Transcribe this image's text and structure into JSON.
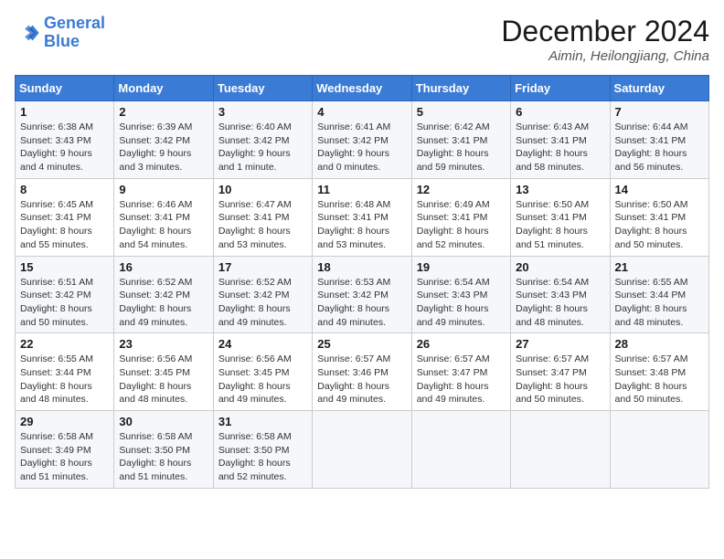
{
  "header": {
    "logo_line1": "General",
    "logo_line2": "Blue",
    "month_title": "December 2024",
    "location": "Aimin, Heilongjiang, China"
  },
  "days_of_week": [
    "Sunday",
    "Monday",
    "Tuesday",
    "Wednesday",
    "Thursday",
    "Friday",
    "Saturday"
  ],
  "weeks": [
    [
      {
        "day": "1",
        "sunrise": "6:38 AM",
        "sunset": "3:43 PM",
        "daylight": "9 hours and 4 minutes."
      },
      {
        "day": "2",
        "sunrise": "6:39 AM",
        "sunset": "3:42 PM",
        "daylight": "9 hours and 3 minutes."
      },
      {
        "day": "3",
        "sunrise": "6:40 AM",
        "sunset": "3:42 PM",
        "daylight": "9 hours and 1 minute."
      },
      {
        "day": "4",
        "sunrise": "6:41 AM",
        "sunset": "3:42 PM",
        "daylight": "9 hours and 0 minutes."
      },
      {
        "day": "5",
        "sunrise": "6:42 AM",
        "sunset": "3:41 PM",
        "daylight": "8 hours and 59 minutes."
      },
      {
        "day": "6",
        "sunrise": "6:43 AM",
        "sunset": "3:41 PM",
        "daylight": "8 hours and 58 minutes."
      },
      {
        "day": "7",
        "sunrise": "6:44 AM",
        "sunset": "3:41 PM",
        "daylight": "8 hours and 56 minutes."
      }
    ],
    [
      {
        "day": "8",
        "sunrise": "6:45 AM",
        "sunset": "3:41 PM",
        "daylight": "8 hours and 55 minutes."
      },
      {
        "day": "9",
        "sunrise": "6:46 AM",
        "sunset": "3:41 PM",
        "daylight": "8 hours and 54 minutes."
      },
      {
        "day": "10",
        "sunrise": "6:47 AM",
        "sunset": "3:41 PM",
        "daylight": "8 hours and 53 minutes."
      },
      {
        "day": "11",
        "sunrise": "6:48 AM",
        "sunset": "3:41 PM",
        "daylight": "8 hours and 53 minutes."
      },
      {
        "day": "12",
        "sunrise": "6:49 AM",
        "sunset": "3:41 PM",
        "daylight": "8 hours and 52 minutes."
      },
      {
        "day": "13",
        "sunrise": "6:50 AM",
        "sunset": "3:41 PM",
        "daylight": "8 hours and 51 minutes."
      },
      {
        "day": "14",
        "sunrise": "6:50 AM",
        "sunset": "3:41 PM",
        "daylight": "8 hours and 50 minutes."
      }
    ],
    [
      {
        "day": "15",
        "sunrise": "6:51 AM",
        "sunset": "3:42 PM",
        "daylight": "8 hours and 50 minutes."
      },
      {
        "day": "16",
        "sunrise": "6:52 AM",
        "sunset": "3:42 PM",
        "daylight": "8 hours and 49 minutes."
      },
      {
        "day": "17",
        "sunrise": "6:52 AM",
        "sunset": "3:42 PM",
        "daylight": "8 hours and 49 minutes."
      },
      {
        "day": "18",
        "sunrise": "6:53 AM",
        "sunset": "3:42 PM",
        "daylight": "8 hours and 49 minutes."
      },
      {
        "day": "19",
        "sunrise": "6:54 AM",
        "sunset": "3:43 PM",
        "daylight": "8 hours and 49 minutes."
      },
      {
        "day": "20",
        "sunrise": "6:54 AM",
        "sunset": "3:43 PM",
        "daylight": "8 hours and 48 minutes."
      },
      {
        "day": "21",
        "sunrise": "6:55 AM",
        "sunset": "3:44 PM",
        "daylight": "8 hours and 48 minutes."
      }
    ],
    [
      {
        "day": "22",
        "sunrise": "6:55 AM",
        "sunset": "3:44 PM",
        "daylight": "8 hours and 48 minutes."
      },
      {
        "day": "23",
        "sunrise": "6:56 AM",
        "sunset": "3:45 PM",
        "daylight": "8 hours and 48 minutes."
      },
      {
        "day": "24",
        "sunrise": "6:56 AM",
        "sunset": "3:45 PM",
        "daylight": "8 hours and 49 minutes."
      },
      {
        "day": "25",
        "sunrise": "6:57 AM",
        "sunset": "3:46 PM",
        "daylight": "8 hours and 49 minutes."
      },
      {
        "day": "26",
        "sunrise": "6:57 AM",
        "sunset": "3:47 PM",
        "daylight": "8 hours and 49 minutes."
      },
      {
        "day": "27",
        "sunrise": "6:57 AM",
        "sunset": "3:47 PM",
        "daylight": "8 hours and 50 minutes."
      },
      {
        "day": "28",
        "sunrise": "6:57 AM",
        "sunset": "3:48 PM",
        "daylight": "8 hours and 50 minutes."
      }
    ],
    [
      {
        "day": "29",
        "sunrise": "6:58 AM",
        "sunset": "3:49 PM",
        "daylight": "8 hours and 51 minutes."
      },
      {
        "day": "30",
        "sunrise": "6:58 AM",
        "sunset": "3:50 PM",
        "daylight": "8 hours and 51 minutes."
      },
      {
        "day": "31",
        "sunrise": "6:58 AM",
        "sunset": "3:50 PM",
        "daylight": "8 hours and 52 minutes."
      },
      null,
      null,
      null,
      null
    ]
  ]
}
